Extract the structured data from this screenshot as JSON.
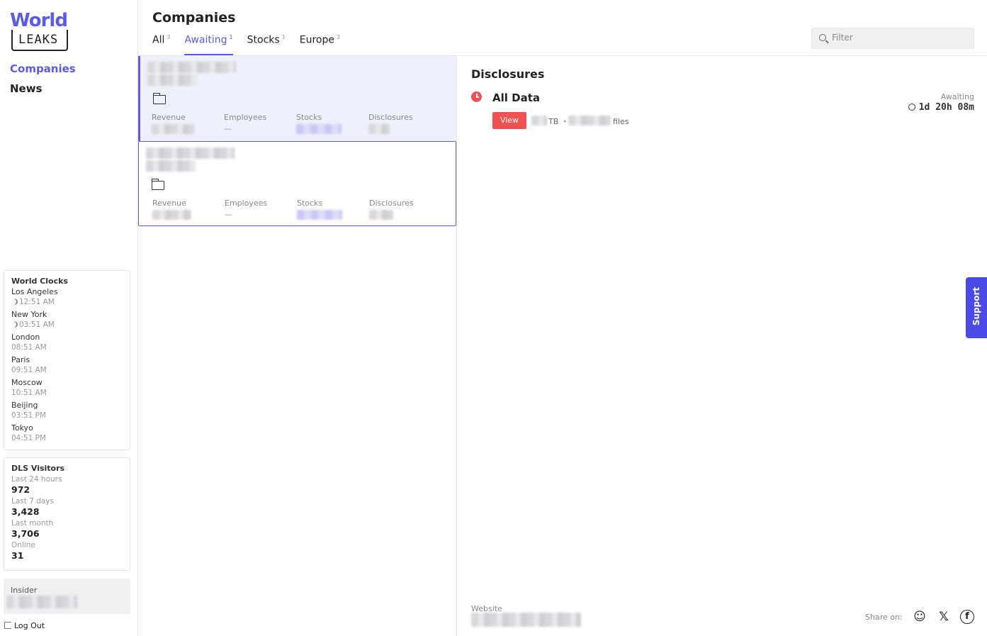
{
  "sidebar": {
    "logo": {
      "top": "World",
      "bottom": "LEAKS"
    },
    "nav": [
      {
        "label": "Companies"
      },
      {
        "label": "News"
      }
    ],
    "world_clocks": {
      "title": "World Clocks",
      "cities": [
        {
          "city": "Los Angeles",
          "time": "12:51 AM",
          "night": true
        },
        {
          "city": "New York",
          "time": "03:51 AM",
          "night": true
        },
        {
          "city": "London",
          "time": "08:51 AM",
          "night": false
        },
        {
          "city": "Paris",
          "time": "09:51 AM",
          "night": false
        },
        {
          "city": "Moscow",
          "time": "10:51 AM",
          "night": false
        },
        {
          "city": "Beijing",
          "time": "03:51 PM",
          "night": false
        },
        {
          "city": "Tokyo",
          "time": "04:51 PM",
          "night": false
        }
      ]
    },
    "visitors": {
      "title": "DLS Visitors",
      "stats": [
        {
          "label": "Last 24 hours",
          "value": "972"
        },
        {
          "label": "Last 7 days",
          "value": "3,428"
        },
        {
          "label": "Last month",
          "value": "3,706"
        },
        {
          "label": "Online",
          "value": "31"
        }
      ]
    },
    "insider_label": "Insider",
    "logout_label": "Log Out"
  },
  "header": {
    "title": "Companies",
    "tabs": [
      {
        "label": "All",
        "count": "3"
      },
      {
        "label": "Awaiting",
        "count": "1"
      },
      {
        "label": "Stocks",
        "count": "1"
      },
      {
        "label": "Europe",
        "count": "3"
      }
    ],
    "filter_placeholder": "Filter"
  },
  "cards": {
    "stat_labels": {
      "revenue": "Revenue",
      "employees": "Employees",
      "stocks": "Stocks",
      "disclosures": "Disclosures"
    },
    "employees_value": "—"
  },
  "detail": {
    "title": "Disclosures",
    "item_title": "All Data",
    "view_label": "View",
    "size_unit": "TB",
    "separator": "•",
    "files_label": "files",
    "status": "Awaiting",
    "countdown": "1d 20h 08m",
    "website_label": "Website",
    "share_label": "Share on:"
  },
  "support_label": "Support",
  "colors": {
    "accent": "#5b5be6",
    "danger": "#f05252",
    "selected_bg": "#eef0fb"
  }
}
